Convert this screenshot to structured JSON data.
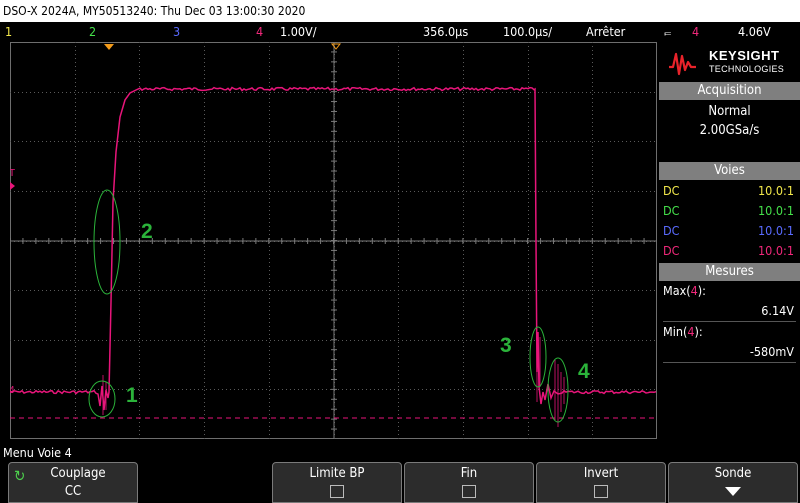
{
  "header": {
    "title": "DSO-X 2024A, MY50513240: Thu Dec 03 13:00:30 2020"
  },
  "channel_bar": {
    "ch1": "1",
    "ch2": "2",
    "ch3": "3",
    "ch4": "4",
    "scale": "1.00V/",
    "time_position": "356.0µs",
    "timebase": "100.0µs/",
    "run_state": "Arrêter",
    "trigger_channel": "4",
    "trigger_level": "4.06V"
  },
  "colors": {
    "ch1": "#f2e84b",
    "ch2": "#45e04a",
    "ch3": "#5a6bff",
    "ch4": "#f0287a",
    "trace": "#e8157a",
    "annotation": "#2bb33a",
    "trigger_marker": "#f29b1a"
  },
  "logo": {
    "line1": "KEYSIGHT",
    "line2": "TECHNOLOGIES"
  },
  "acquisition": {
    "header": "Acquisition",
    "mode": "Normal",
    "rate": "2.00GSa/s"
  },
  "voies": {
    "header": "Voies",
    "rows": [
      {
        "coupling": "DC",
        "probe": "10.0:1"
      },
      {
        "coupling": "DC",
        "probe": "10.0:1"
      },
      {
        "coupling": "DC",
        "probe": "10.0:1"
      },
      {
        "coupling": "DC",
        "probe": "10.0:1"
      }
    ]
  },
  "mesures": {
    "header": "Mesures",
    "max_label": "Max(",
    "max_ch": "4",
    "max_close": "):",
    "max_value": "6.14V",
    "min_label": "Min(",
    "min_ch": "4",
    "min_close": "):",
    "min_value": "-580mV"
  },
  "annotations": [
    "1",
    "2",
    "3",
    "4"
  ],
  "menu": {
    "label": "Menu Voie 4",
    "softkeys": {
      "couplage": {
        "label": "Couplage",
        "value": "CC"
      },
      "limite_bp": {
        "label": "Limite BP"
      },
      "fin": {
        "label": "Fin"
      },
      "invert": {
        "label": "Invert"
      },
      "sonde": {
        "label": "Sonde"
      }
    }
  }
}
